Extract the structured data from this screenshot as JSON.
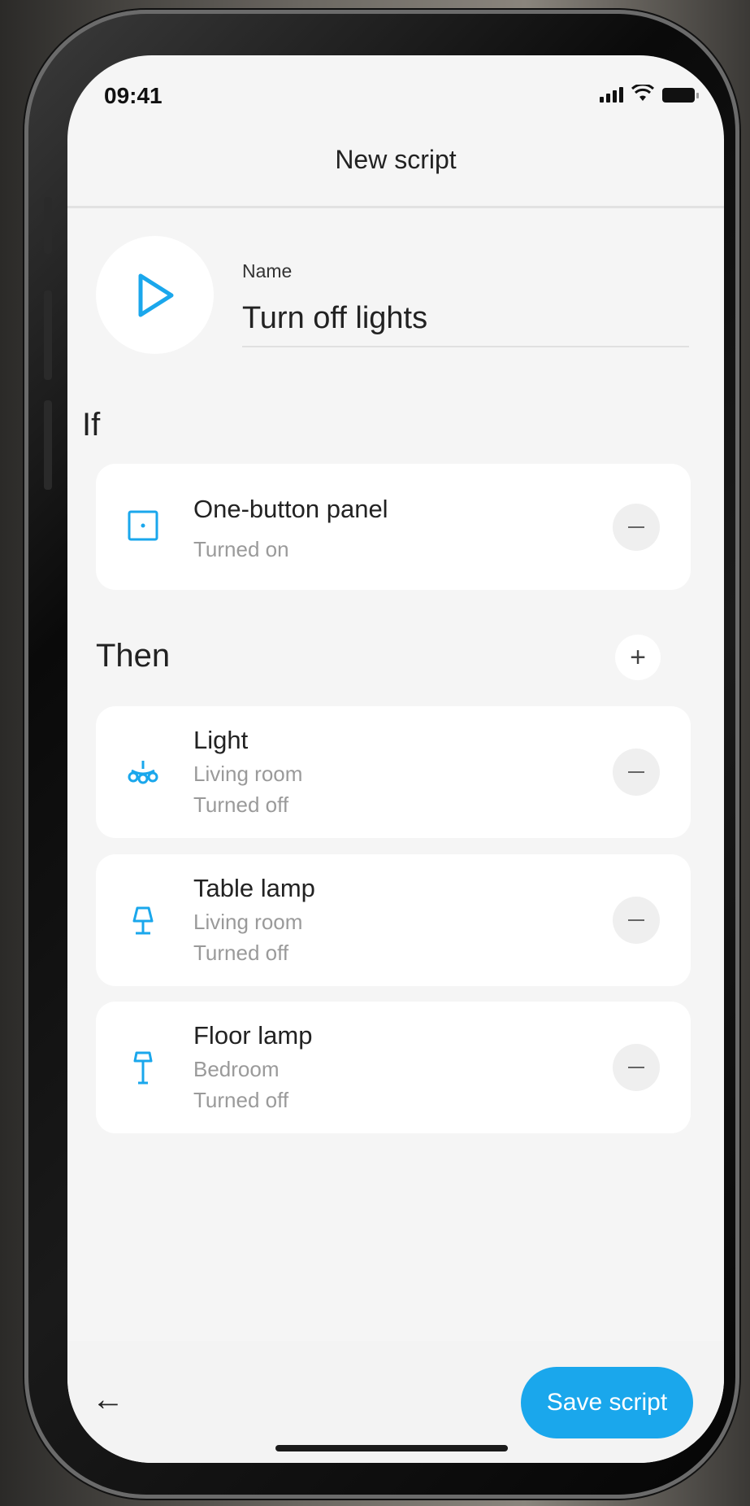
{
  "status_bar": {
    "time": "09:41"
  },
  "header": {
    "title": "New script"
  },
  "name_field": {
    "label": "Name",
    "value": "Turn off lights"
  },
  "if_section": {
    "label": "If",
    "items": [
      {
        "title": "One-button panel",
        "line1": "Turned on",
        "icon": "panel-icon"
      }
    ]
  },
  "then_section": {
    "label": "Then",
    "add_label": "+",
    "items": [
      {
        "title": "Light",
        "line1": "Living room",
        "line2": "Turned off",
        "icon": "chandelier-icon"
      },
      {
        "title": "Table lamp",
        "line1": "Living room",
        "line2": "Turned off",
        "icon": "table-lamp-icon"
      },
      {
        "title": "Floor lamp",
        "line1": "Bedroom",
        "line2": "Turned off",
        "icon": "floor-lamp-icon"
      }
    ]
  },
  "footer": {
    "back_label": "←",
    "save_label": "Save script"
  },
  "colors": {
    "accent": "#1aa7ec",
    "background": "#f5f5f5",
    "card": "#ffffff"
  }
}
